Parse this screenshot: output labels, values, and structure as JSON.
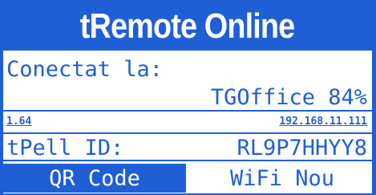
{
  "header": {
    "title": "tRemote Online"
  },
  "connection": {
    "label": "Conectat la:",
    "network": "TGOffice 84%"
  },
  "info": {
    "version": "1.64",
    "ip": "192.168.11.111"
  },
  "device": {
    "label": "tPell ID:",
    "id": "RL9P7HHYY8"
  },
  "buttons": {
    "qr_code": "QR Code",
    "wifi_new": "WiFi Nou"
  },
  "colors": {
    "accent": "#1f5fd6",
    "background": "#ffffff"
  }
}
